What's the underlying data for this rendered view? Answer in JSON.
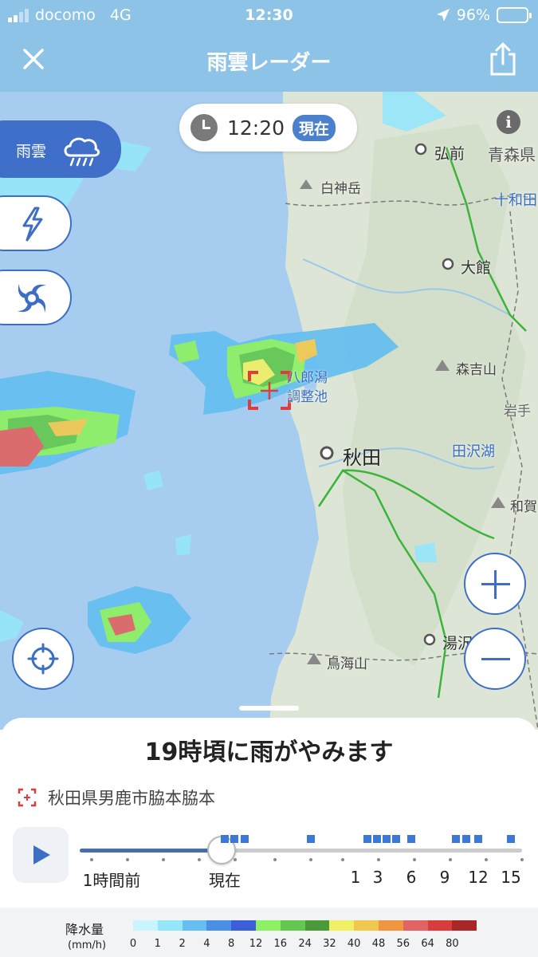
{
  "status_bar": {
    "carrier": "docomo",
    "network": "4G",
    "time": "12:30",
    "battery": "96%",
    "battery_level": 0.96
  },
  "nav": {
    "title": "雨雲レーダー",
    "close_icon": "close-icon",
    "share_icon": "share-icon"
  },
  "time_pill": {
    "time": "12:20",
    "badge": "現在"
  },
  "layers": [
    {
      "label": "雨雲",
      "icon": "rain-cloud-icon",
      "active": true
    },
    {
      "label": "",
      "icon": "lightning-icon",
      "active": false
    },
    {
      "label": "",
      "icon": "typhoon-icon",
      "active": false
    }
  ],
  "map": {
    "labels": {
      "hirosaki": "弘前",
      "aomori": "青森県",
      "shirakami": "白神岳",
      "towada": "十和田",
      "odate": "大館",
      "moriyoshi": "森吉山",
      "hachiro1": "八郎潟",
      "hachiro2": "調整池",
      "iwate": "岩手",
      "tazawa": "田沢湖",
      "akita": "秋田",
      "waga": "和賀",
      "yuzawa": "湯沢",
      "chokai": "鳥海山"
    },
    "zoom_in_icon": "plus-icon",
    "zoom_out_icon": "minus-icon",
    "locate_icon": "locate-icon"
  },
  "panel": {
    "headline": "19時頃に雨がやみます",
    "location": "秋田県男鹿市脇本脇本",
    "timeline": {
      "labels": [
        "1時間前",
        "現在",
        "1",
        "3",
        "6",
        "9",
        "12",
        "15"
      ],
      "current_fraction": 0.32
    }
  },
  "legend": {
    "title": "降水量",
    "unit": "(mm/h)",
    "colors": [
      "#c8f4ff",
      "#96e6fa",
      "#64bef0",
      "#4a8ee6",
      "#3c5ed8",
      "#8ef064",
      "#64c850",
      "#4a9a3c",
      "#f0f064",
      "#f0c850",
      "#f09640",
      "#e06464",
      "#d83c3c",
      "#a82828"
    ],
    "values": [
      "0",
      "1",
      "2",
      "4",
      "8",
      "12",
      "16",
      "24",
      "32",
      "40",
      "48",
      "56",
      "64",
      "80"
    ]
  }
}
